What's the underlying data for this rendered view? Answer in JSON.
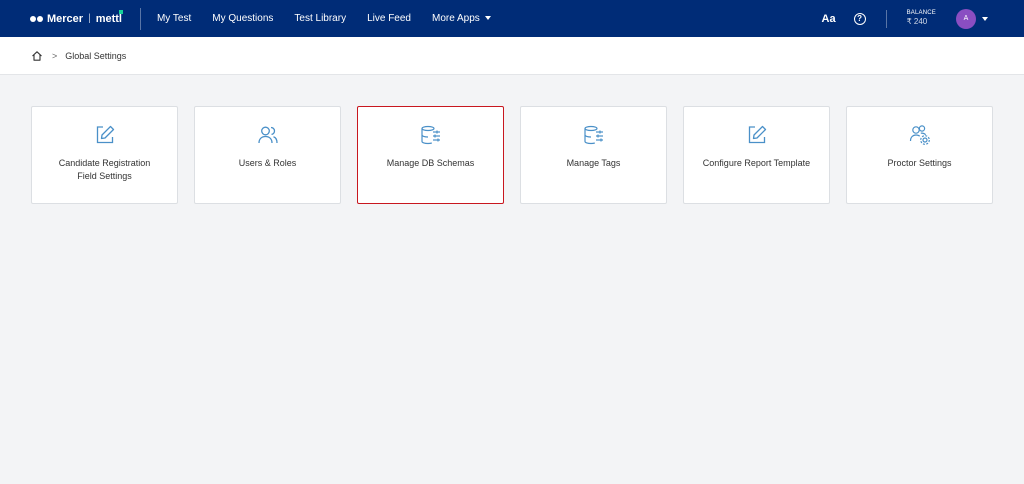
{
  "header": {
    "brand": {
      "mercer": "Mercer",
      "separator": "|",
      "mettl": "mettl"
    },
    "nav": [
      {
        "label": "My Test"
      },
      {
        "label": "My Questions"
      },
      {
        "label": "Test Library"
      },
      {
        "label": "Live Feed"
      },
      {
        "label": "More Apps"
      }
    ],
    "font_toggle": "Aa",
    "help": "?",
    "balance_label": "BALANCE",
    "balance_value": "₹ 240",
    "avatar_initial": "A"
  },
  "breadcrumb": {
    "separator": ">",
    "current": "Global Settings"
  },
  "cards": [
    {
      "label_line1": "Candidate Registration",
      "label_line2": "Field Settings",
      "icon": "edit-icon",
      "selected": false
    },
    {
      "label_line1": "Users & Roles",
      "label_line2": "",
      "icon": "users-icon",
      "selected": false
    },
    {
      "label_line1": "Manage DB Schemas",
      "label_line2": "",
      "icon": "database-settings-icon",
      "selected": true
    },
    {
      "label_line1": "Manage Tags",
      "label_line2": "",
      "icon": "database-settings-icon",
      "selected": false
    },
    {
      "label_line1": "Configure Report Template",
      "label_line2": "",
      "icon": "edit-icon",
      "selected": false
    },
    {
      "label_line1": "Proctor Settings",
      "label_line2": "",
      "icon": "users-gear-icon",
      "selected": false
    }
  ],
  "colors": {
    "nav_bg": "#002c77",
    "icon_blue": "#4a90c8",
    "selected_border": "#c8171f",
    "avatar": "#8a4ec2"
  }
}
